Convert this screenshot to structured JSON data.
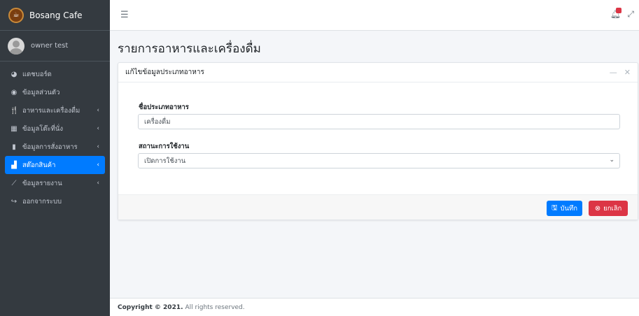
{
  "brand": {
    "name": "Bosang Cafe"
  },
  "user": {
    "name": "owner test"
  },
  "sidebar": {
    "items": [
      {
        "label": "แดชบอร์ด",
        "icon": "tachometer-icon",
        "glyph": "◕",
        "chevron": false,
        "active": false
      },
      {
        "label": "ข้อมูลส่วนตัว",
        "icon": "user-circle-icon",
        "glyph": "◉",
        "chevron": false,
        "active": false
      },
      {
        "label": "อาหารและเครื่องดื่ม",
        "icon": "utensils-icon",
        "glyph": "🍴",
        "chevron": true,
        "active": false
      },
      {
        "label": "ข้อมูลโต๊ะที่นั่ง",
        "icon": "table-icon",
        "glyph": "▦",
        "chevron": true,
        "active": false
      },
      {
        "label": "ข้อมูลการสั่งอาหาร",
        "icon": "clipboard-icon",
        "glyph": "▮",
        "chevron": true,
        "active": false
      },
      {
        "label": "สต๊อกสินค้า",
        "icon": "boxes-icon",
        "glyph": "▟",
        "chevron": true,
        "active": true
      },
      {
        "label": "ข้อมูลรายงาน",
        "icon": "chart-line-icon",
        "glyph": "⟋",
        "chevron": true,
        "active": false
      },
      {
        "label": "ออกจากระบบ",
        "icon": "sign-out-icon",
        "glyph": "↪",
        "chevron": false,
        "active": false
      }
    ]
  },
  "page": {
    "title": "รายการอาหารและเครื่องดื่ม"
  },
  "card": {
    "title": "แก้ไขข้อมูลประเภทอาหาร",
    "fields": {
      "type_label": "ชื่อประเภทอาหาร",
      "type_value": "เครื่องดื่ม",
      "status_label": "สถานะการใช้งาน",
      "status_value": "เปิดการใช้งาน"
    },
    "buttons": {
      "save": "บันทึก",
      "cancel": "ยกเลิก"
    }
  },
  "footer": {
    "copyright": "Copyright © 2021.",
    "rights": "All rights reserved."
  },
  "colors": {
    "sidebar_bg": "#343a40",
    "primary": "#007bff",
    "danger": "#dc3545"
  }
}
